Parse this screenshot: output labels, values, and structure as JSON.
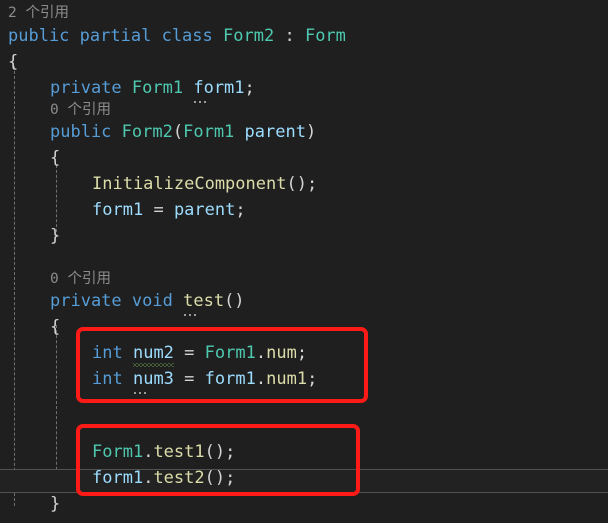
{
  "editor": {
    "background_color": "#1f1f1f",
    "default_text_color": "#d4d4d4",
    "current_line_background": "#222222",
    "current_line_border_color": "#525252",
    "indent_guide_color": "#707070",
    "annotation_color": "#fc1b16"
  },
  "theme_colors": {
    "keyword": "#569cd6",
    "type": "#4ec9b0",
    "variable": "#9cdcfe",
    "method": "#dcdcaa",
    "punctuation": "#d4d4d4",
    "codelens": "#8c8c8c",
    "squiggle_green": "#6a9955"
  },
  "codelens": [
    {
      "id": "class-form2",
      "text": "2 个引用"
    },
    {
      "id": "ctor-form2",
      "text": "0 个引用"
    },
    {
      "id": "method-test",
      "text": "0 个引用"
    }
  ],
  "code": {
    "class_decl": {
      "kw_public": "public",
      "kw_partial": "partial",
      "kw_class": "class",
      "name": "Form2",
      "colon": ":",
      "base": "Form"
    },
    "class_open_brace": "{",
    "field_decl": {
      "kw_private": "private",
      "type": "Form1",
      "name": "form1",
      "semicolon": ";"
    },
    "ctor_decl": {
      "kw_public": "public",
      "name": "Form2",
      "open_paren": "(",
      "param_type": "Form1",
      "param_name": "parent",
      "close_paren": ")"
    },
    "ctor_open_brace": "{",
    "ctor_body": {
      "line1_call": "InitializeComponent",
      "line1_parens": "();",
      "line2_lhs": "form1",
      "line2_eq": "=",
      "line2_rhs": "parent",
      "line2_semi": ";"
    },
    "ctor_close_brace": "}",
    "method_decl": {
      "kw_private": "private",
      "kw_void": "void",
      "name": "test",
      "parens": "()"
    },
    "method_open_brace": "{",
    "method_body": {
      "stmt1": {
        "kw_int": "int",
        "name": "num2",
        "eq": "=",
        "qualifier": "Form1",
        "dot": ".",
        "member": "num",
        "semi": ";"
      },
      "stmt2": {
        "kw_int": "int",
        "name": "num3",
        "eq": "=",
        "qualifier": "form1",
        "dot": ".",
        "member": "num1",
        "semi": ";"
      },
      "stmt3": {
        "qualifier": "Form1",
        "dot": ".",
        "member": "test1",
        "parens": "();"
      },
      "stmt4": {
        "qualifier": "form1",
        "dot": ".",
        "member": "test2",
        "parens": "();"
      }
    },
    "method_close_brace": "}"
  },
  "annotations": [
    {
      "id": "redbox-field-access",
      "label": "red-highlight-box-field-access"
    },
    {
      "id": "redbox-method-call",
      "label": "red-highlight-box-method-call"
    }
  ]
}
